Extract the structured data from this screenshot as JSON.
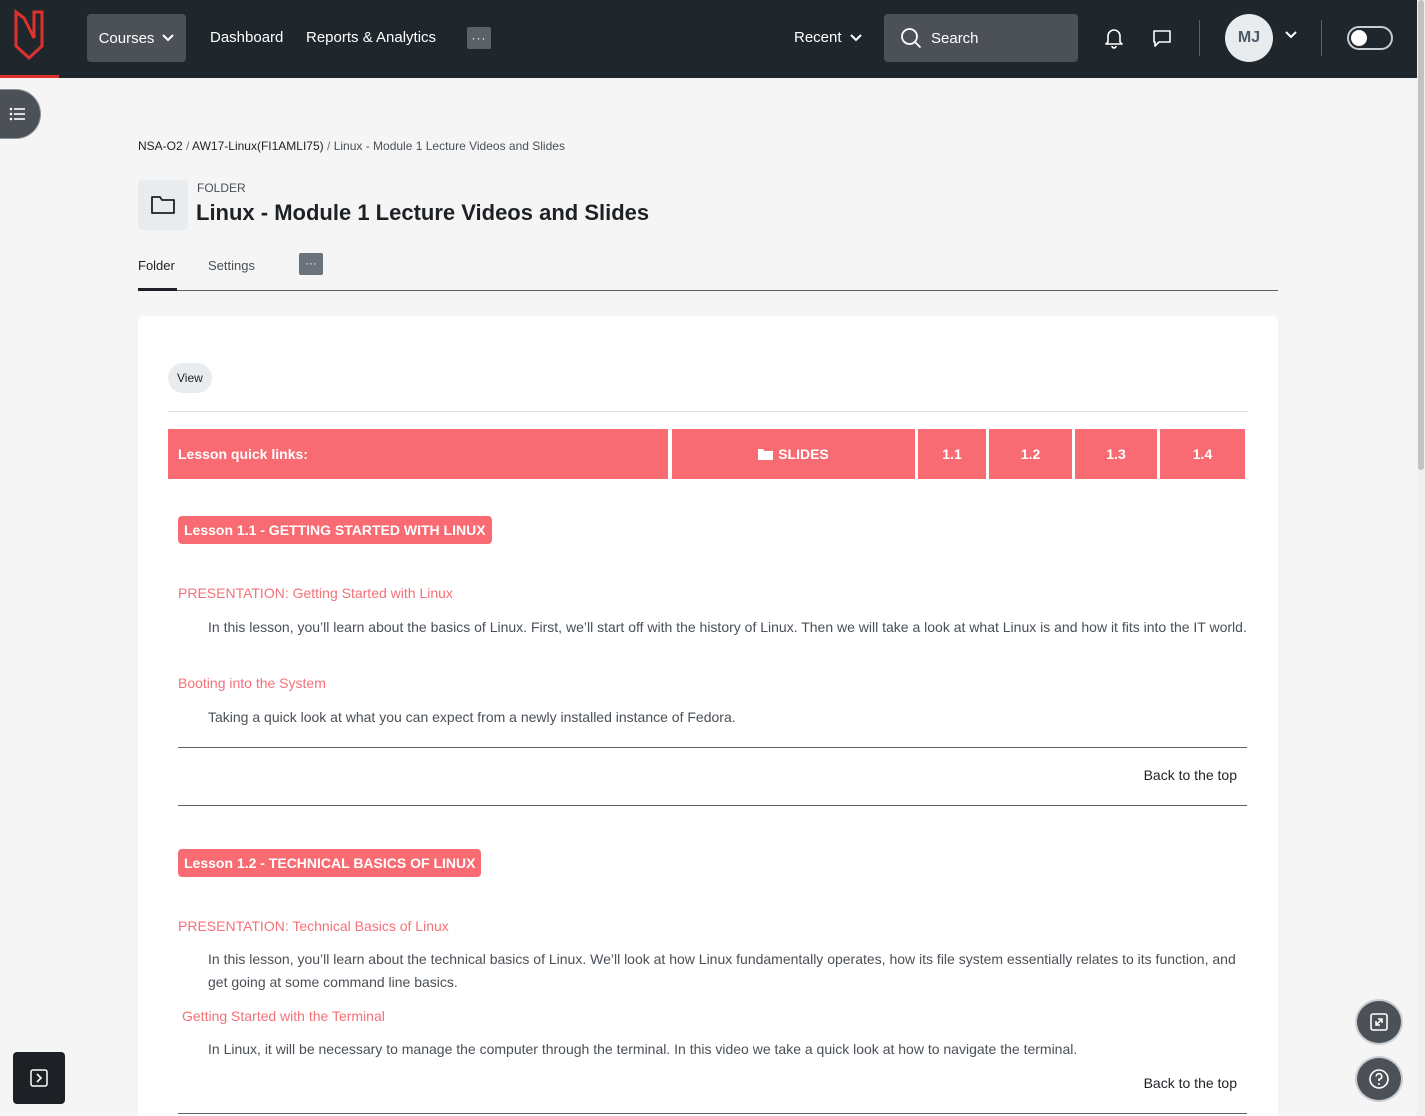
{
  "navbar": {
    "courses_label": "Courses",
    "dashboard_label": "Dashboard",
    "reports_label": "Reports & Analytics",
    "more_label": "···",
    "recent_label": "Recent",
    "search_placeholder": "Search",
    "avatar_initials": "MJ"
  },
  "breadcrumb": {
    "items": [
      "NSA-O2",
      "AW17-Linux(FI1AMLI75)",
      "Linux - Module 1 Lecture Videos and Slides"
    ],
    "separator": "/"
  },
  "header": {
    "type_label": "FOLDER",
    "title": "Linux - Module 1 Lecture Videos and Slides"
  },
  "tabs": {
    "folder": "Folder",
    "settings": "Settings",
    "more": "···"
  },
  "content": {
    "view_label": "View",
    "quick_links": {
      "heading": "Lesson quick links:",
      "slides": "SLIDES",
      "items": [
        "1.1",
        "1.2",
        "1.3",
        "1.4"
      ]
    },
    "lessons": [
      {
        "badge": "Lesson 1.1 - GETTING STARTED WITH LINUX",
        "presentation_link": "PRESENTATION: Getting Started with Linux",
        "presentation_desc": "In this lesson, you’ll learn about the basics of Linux. First, we’ll start off with the history of Linux. Then we will take a look at what Linux is and how it fits into the IT world.",
        "video_link": "Booting into the System",
        "video_desc": "Taking a quick look at what you can expect from a newly installed instance of Fedora.",
        "back_to_top": "Back to the top"
      },
      {
        "badge": "Lesson 1.2 - TECHNICAL BASICS OF LINUX",
        "presentation_link": "PRESENTATION: Technical Basics of Linux",
        "presentation_desc": "In this lesson, you’ll learn about the technical basics of Linux. We’ll look at how Linux fundamentally operates, how its file system essentially relates to its function, and get going at some command line basics.",
        "video_link": "Getting Started with the Terminal",
        "video_desc": "In Linux, it will be necessary to manage the computer through the terminal. In this video we take a quick look at how to navigate the terminal.",
        "back_to_top": "Back to the top"
      }
    ]
  },
  "colors": {
    "navbar_bg": "#1f272d",
    "accent": "#f96b73",
    "link": "#f47178",
    "brand_red": "#e0322d"
  }
}
